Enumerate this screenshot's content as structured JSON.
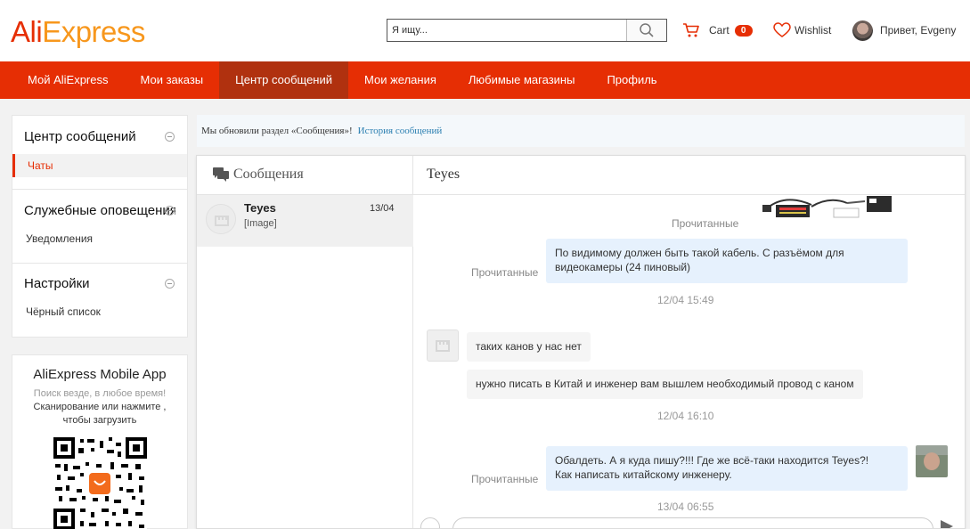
{
  "header": {
    "logo_ali": "Ali",
    "logo_express": "Express",
    "search_placeholder": "Я ищу...",
    "cart_label": "Cart",
    "cart_count": "0",
    "wishlist_label": "Wishlist",
    "user_greeting": "Привет, Evgeny"
  },
  "nav": {
    "items": [
      {
        "label": "Мой AliExpress"
      },
      {
        "label": "Мои заказы"
      },
      {
        "label": "Центр сообщений"
      },
      {
        "label": "Мои желания"
      },
      {
        "label": "Любимые магазины"
      },
      {
        "label": "Профиль"
      }
    ],
    "active_index": 2
  },
  "sidebar": {
    "sections": [
      {
        "title": "Центр сообщений",
        "items": [
          "Чаты"
        ]
      },
      {
        "title": "Служебные оповещения",
        "items": [
          "Уведомления"
        ]
      },
      {
        "title": "Настройки",
        "items": [
          "Чёрный список"
        ]
      }
    ],
    "active_item": "Чаты"
  },
  "app_promo": {
    "title": "AliExpress Mobile App",
    "line1": "Поиск везде, в любое время!",
    "line2": "Сканирование или нажмите ,",
    "line3": "чтобы загрузить"
  },
  "notice": {
    "text": "Мы обновили раздел «Сообщения»!",
    "link": "История сообщений"
  },
  "conversations": {
    "header": "Сообщения",
    "items": [
      {
        "name": "Teyes",
        "preview": "[Image]",
        "date": "13/04"
      }
    ]
  },
  "thread": {
    "title": "Teyes",
    "messages": [
      {
        "from": "me",
        "type": "image",
        "status": "Прочитанные"
      },
      {
        "from": "me",
        "text_line1": "По видимому должен быть такой кабель. С разъёмом для",
        "text_line2": "видеокамеры (24 пиновый)",
        "status": "Прочитанные"
      },
      {
        "type": "timestamp",
        "text": "12/04 15:49"
      },
      {
        "from": "seller",
        "text": "таких канов у нас нет"
      },
      {
        "from": "seller",
        "text": "нужно писать в Китай и инженер вам вышлем необходимый провод с каном"
      },
      {
        "type": "timestamp",
        "text": "12/04 16:10"
      },
      {
        "from": "me",
        "text_line1": "Обалдеть. А я куда пишу?!!! Где же всё-таки находится Teyes?!",
        "text_line2": "Как написать китайскому инженеру.",
        "status": "Прочитанные"
      },
      {
        "type": "timestamp",
        "text": "13/04 06:55"
      }
    ]
  },
  "colors": {
    "brand": "#e62e04",
    "nav_active": "#b0310f",
    "outgoing_bubble": "#e6f1fd",
    "incoming_bubble": "#f5f5f5"
  }
}
